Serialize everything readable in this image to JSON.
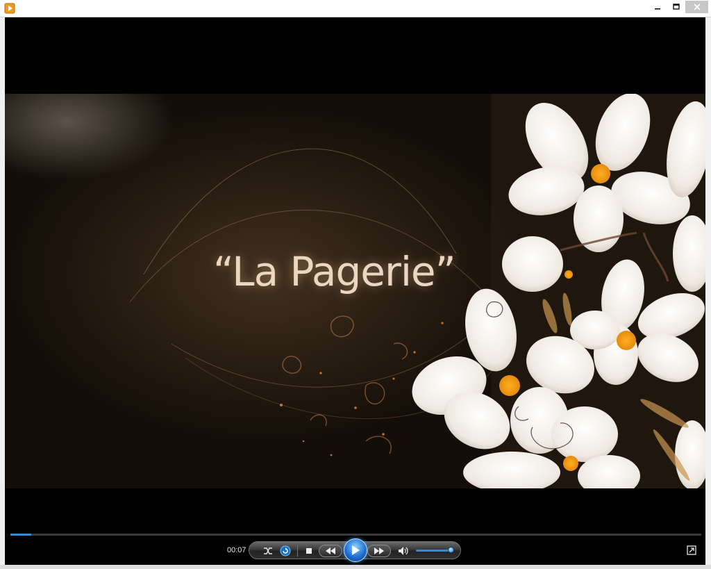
{
  "window": {
    "icon": "media-player-icon",
    "controls": [
      "minimize-icon",
      "maximize-icon",
      "close-icon"
    ]
  },
  "video": {
    "title_text": "“La Pagerie”"
  },
  "player": {
    "elapsed_time": "00:07",
    "seek_progress": 0.03,
    "volume_level": 0.9,
    "accent_color": "#2f8fd4",
    "buttons": [
      "shuffle-icon",
      "repeat-icon",
      "stop-icon",
      "previous-icon",
      "play-icon",
      "next-icon",
      "volume-icon",
      "switch-to-library-icon"
    ]
  }
}
